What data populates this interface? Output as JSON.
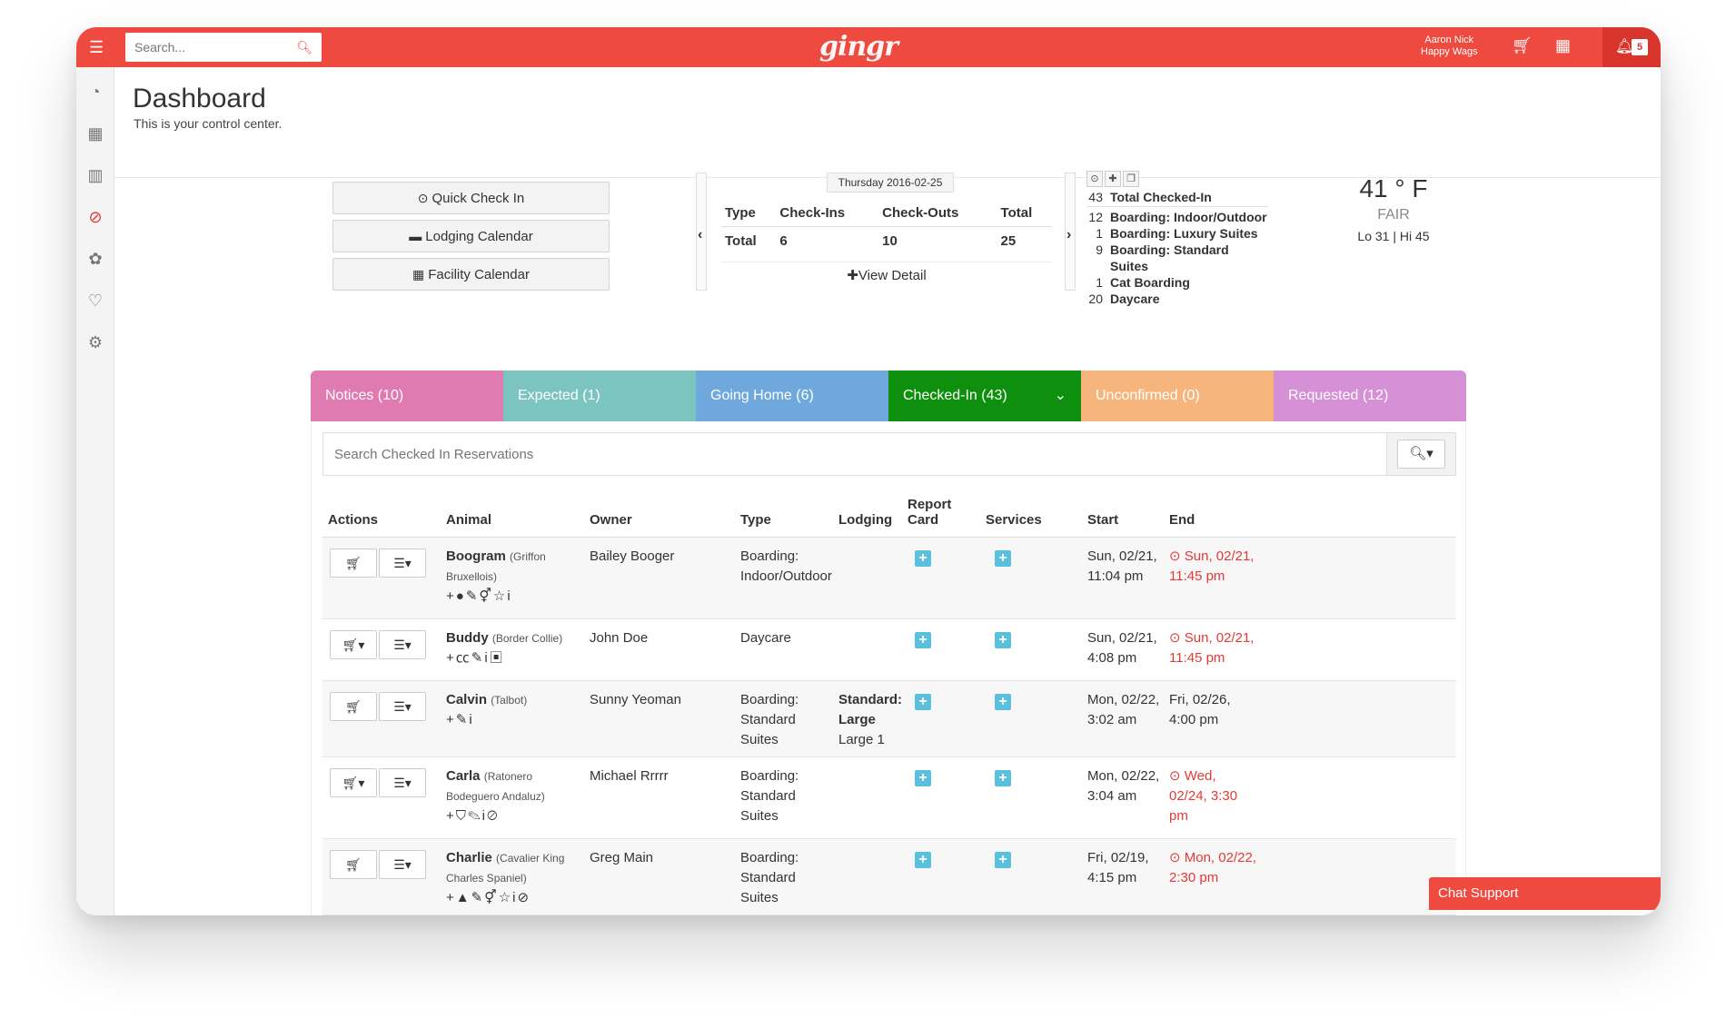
{
  "topbar": {
    "search_placeholder": "Search...",
    "logo": "gingr",
    "user_name": "Aaron Nick",
    "user_company": "Happy Wags",
    "notification_count": "5",
    "accent": "#ee4a40"
  },
  "header": {
    "title": "Dashboard",
    "subtitle": "This is your control center."
  },
  "quick": {
    "check_in": "Quick Check In",
    "lodging": "Lodging Calendar",
    "facility": "Facility Calendar"
  },
  "stats": {
    "date": "Thursday 2016-02-25",
    "headers": [
      "Type",
      "Check-Ins",
      "Check-Outs",
      "Total"
    ],
    "row": [
      "Total",
      "6",
      "10",
      "25"
    ],
    "view_detail": "View Detail"
  },
  "checked_in": {
    "total_count": "43",
    "total_label": "Total Checked-In",
    "rows": [
      {
        "n": "12",
        "label": "Boarding: Indoor/Outdoor"
      },
      {
        "n": "1",
        "label": "Boarding: Luxury Suites"
      },
      {
        "n": "9",
        "label": "Boarding: Standard Suites"
      },
      {
        "n": "1",
        "label": "Cat Boarding"
      },
      {
        "n": "20",
        "label": "Daycare"
      }
    ]
  },
  "weather": {
    "temp": "41 ° F",
    "condition": "FAIR",
    "range": "Lo 31 | Hi 45"
  },
  "tabs": [
    {
      "label": "Notices (10)",
      "color": "#e07bb1"
    },
    {
      "label": "Expected (1)",
      "color": "#7cc4c0"
    },
    {
      "label": "Going Home (6)",
      "color": "#6fa8dc"
    },
    {
      "label": "Checked-In (43)",
      "color": "#0e8f0e"
    },
    {
      "label": "Unconfirmed (0)",
      "color": "#f5b57c"
    },
    {
      "label": "Requested (12)",
      "color": "#d690d6"
    }
  ],
  "reservations": {
    "search_placeholder": "Search Checked In Reservations",
    "columns": [
      "Actions",
      "Animal",
      "Owner",
      "Type",
      "Lodging",
      "Report Card",
      "Services",
      "Start",
      "End"
    ],
    "rows": [
      {
        "name": "Boogram",
        "breed": "(Griffon Bruxellois)",
        "flags": "+●✎⚥☆i",
        "owner": "Bailey Booger",
        "type": "Boarding: Indoor/Outdoor",
        "lodging": "",
        "lodging_sub": "",
        "start": "Sun, 02/21, 11:04 pm",
        "end": "Sun, 02/21, 11:45 pm",
        "overdue": true
      },
      {
        "name": "Buddy",
        "breed": "(Border Collie)",
        "flags": "+㏄✎i▣",
        "owner": "John Doe",
        "type": "Daycare",
        "lodging": "",
        "lodging_sub": "",
        "start": "Sun, 02/21, 4:08 pm",
        "end": "Sun, 02/21, 11:45 pm",
        "overdue": true
      },
      {
        "name": "Calvin",
        "breed": "(Talbot)",
        "flags": "+✎i",
        "owner": "Sunny Yeoman",
        "type": "Boarding: Standard Suites",
        "lodging": "Standard: Large",
        "lodging_sub": "Large 1",
        "start": "Mon, 02/22, 3:02 am",
        "end": "Fri, 02/26, 4:00 pm",
        "overdue": false
      },
      {
        "name": "Carla",
        "breed": "(Ratonero Bodeguero Andaluz)",
        "flags": "+⛉✎i⊘",
        "owner": "Michael Rrrrr",
        "type": "Boarding: Standard Suites",
        "lodging": "",
        "lodging_sub": "",
        "start": "Mon, 02/22, 3:04 am",
        "end": "Wed, 02/24, 3:30 pm",
        "overdue": true
      },
      {
        "name": "Charlie",
        "breed": "(Cavalier King Charles Spaniel)",
        "flags": "+▲✎⚥☆i⊘",
        "owner": "Greg Main",
        "type": "Boarding: Standard Suites",
        "lodging": "",
        "lodging_sub": "",
        "start": "Fri, 02/19, 4:15 pm",
        "end": "Mon, 02/22, 2:30 pm",
        "overdue": true
      }
    ]
  },
  "chat": {
    "label": "Chat Support"
  }
}
